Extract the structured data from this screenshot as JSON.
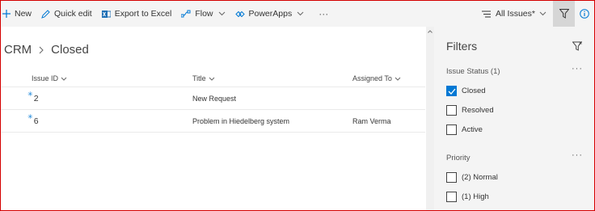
{
  "toolbar": {
    "new_label": "New",
    "quick_edit_label": "Quick edit",
    "export_label": "Export to Excel",
    "flow_label": "Flow",
    "powerapps_label": "PowerApps",
    "more_label": "···",
    "view_label": "All Issues*"
  },
  "breadcrumb": {
    "parent": "CRM",
    "current": "Closed"
  },
  "table": {
    "columns": [
      "Issue ID",
      "Title",
      "Assigned To"
    ],
    "rows": [
      {
        "id": "2",
        "title": "New Request",
        "assigned": ""
      },
      {
        "id": "6",
        "title": "Problem in Hiedelberg system",
        "assigned": "Ram Verma"
      }
    ]
  },
  "filters": {
    "title": "Filters",
    "more_label": "···",
    "groups": [
      {
        "title": "Issue Status (1)",
        "options": [
          {
            "label": "Closed",
            "checked": true
          },
          {
            "label": "Resolved",
            "checked": false
          },
          {
            "label": "Active",
            "checked": false
          }
        ]
      },
      {
        "title": "Priority",
        "options": [
          {
            "label": "(2) Normal",
            "checked": false
          },
          {
            "label": "(1) High",
            "checked": false
          }
        ]
      }
    ]
  },
  "colors": {
    "accent": "#0078d4",
    "frame_border": "#d40000",
    "pane_bg": "#f4f4f4"
  },
  "icons": [
    "plus-icon",
    "pencil-icon",
    "excel-icon",
    "flow-icon",
    "powerapps-icon",
    "view-list-icon",
    "filter-icon",
    "info-icon",
    "chevron-down-icon",
    "chevron-right-icon",
    "new-item-spark-icon",
    "checkmark-icon"
  ]
}
